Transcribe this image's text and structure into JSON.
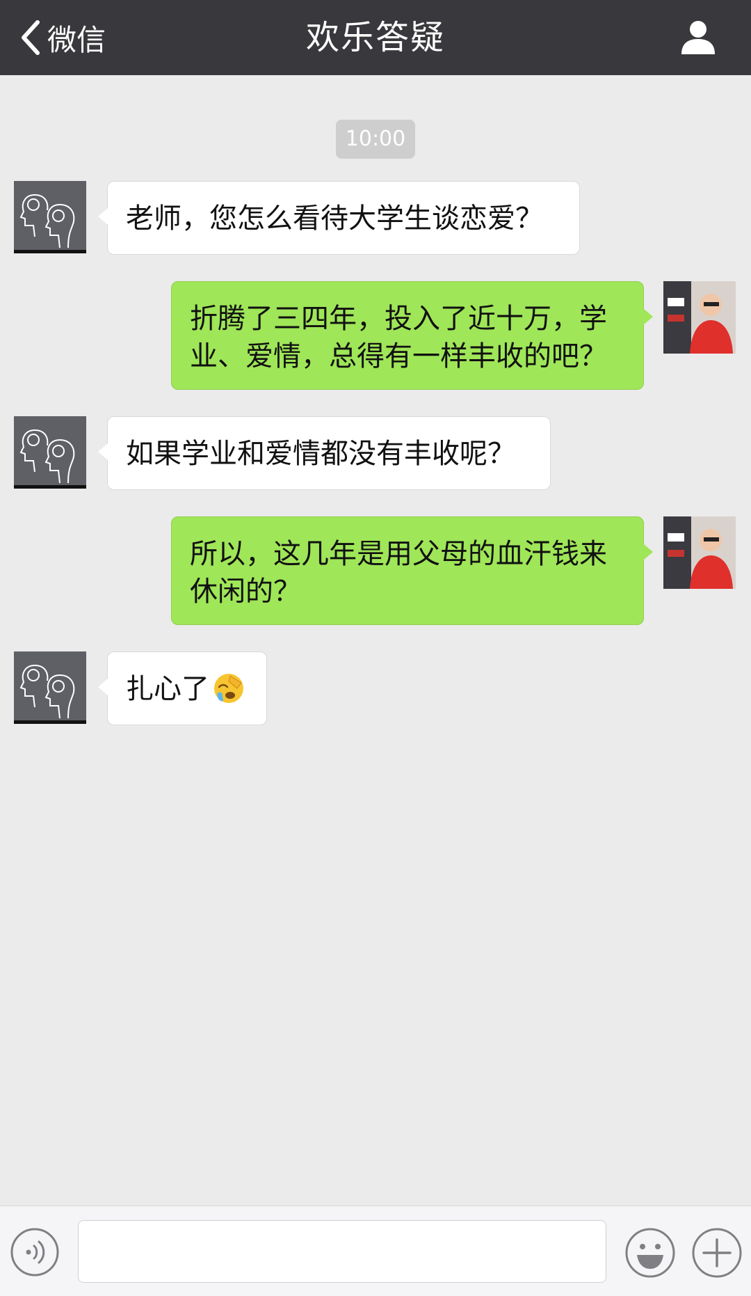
{
  "navbar": {
    "back_label": "微信",
    "title": "欢乐答疑",
    "back_icon": "chevron-left-icon",
    "profile_icon": "person-icon"
  },
  "chat": {
    "timestamp": "10:00",
    "messages": [
      {
        "side": "left",
        "text": "老师，您怎么看待大学生谈恋爱？"
      },
      {
        "side": "right",
        "text": "折腾了三四年，投入了近十万，学业、爱情，总得有一样丰收的吧？"
      },
      {
        "side": "left",
        "text": "如果学业和爱情都没有丰收呢？"
      },
      {
        "side": "right",
        "text": "所以，这几年是用父母的血汗钱来休闲的？"
      },
      {
        "side": "left",
        "text": "扎心了",
        "emoji": "face-palm-emoji"
      }
    ]
  },
  "inputbar": {
    "value": "",
    "voice_icon": "voice-icon",
    "emoji_icon": "smiley-icon",
    "plus_icon": "plus-icon"
  },
  "colors": {
    "navbar_bg": "#39383c",
    "chat_bg": "#ebebeb",
    "bubble_self": "#9fe658",
    "bubble_other": "#ffffff",
    "timestamp_bg": "#cecece"
  }
}
